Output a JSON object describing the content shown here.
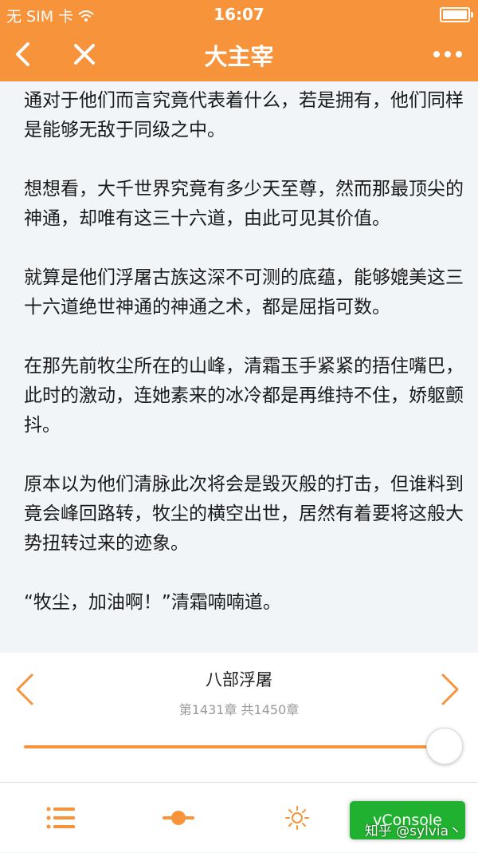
{
  "status_bar": {
    "carrier": "无 SIM 卡",
    "time": "16:07",
    "battery_level": 0.95
  },
  "nav": {
    "title": "大主宰",
    "back_icon": "chevron-left-icon",
    "close_icon": "close-icon",
    "more_icon": "more-dots-icon"
  },
  "content": {
    "paragraphs": [
      "通对于他们而言究竟代表着什么，若是拥有，他们同样是能够无敌于同级之中。",
      "想想看，大千世界究竟有多少天至尊，然而那最顶尖的神通，却唯有这三十六道，由此可见其价值。",
      "就算是他们浮屠古族这深不可测的底蕴，能够媲美这三十六道绝世神通的神通之术，都是屈指可数。",
      "在那先前牧尘所在的山峰，清霜玉手紧紧的捂住嘴巴，此时的激动，连她素来的冰冷都是再维持不住，娇躯颤抖。",
      "原本以为他们清脉此次将会是毁灭般的打击，但谁料到竟会峰回路转，牧尘的横空出世，居然有着要将这般大势扭转过来的迹象。",
      "“牧尘，加油啊！”清霜喃喃道。"
    ]
  },
  "chapter": {
    "title": "八部浮屠",
    "info": "第1431章 共1450章",
    "progress": 0.987
  },
  "toolbar": {
    "toc_icon": "list-icon",
    "mode_icon": "night-mode-icon",
    "brightness_icon": "brightness-icon"
  },
  "vconsole": {
    "label": "vConsole"
  },
  "watermark": {
    "text": "知乎 @sylvia丶"
  },
  "colors": {
    "accent": "#f7933a",
    "background": "#f2f5f8",
    "vconsole": "#1fb12f"
  }
}
